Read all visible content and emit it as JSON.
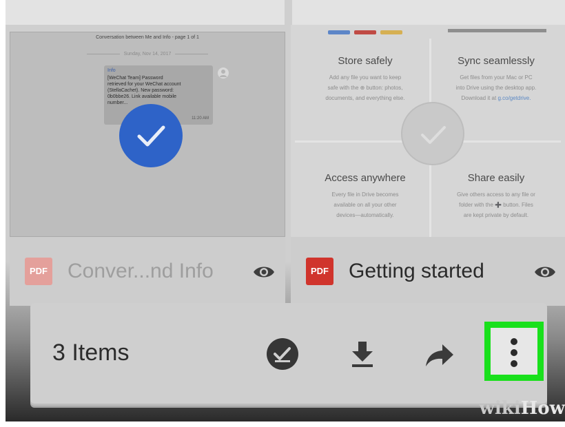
{
  "left_card": {
    "doc_header": "Conversation between Me and Info - page 1 of 1",
    "doc_date": "Sunday, Nov 14, 2017",
    "message": {
      "sender": "Info",
      "body": "[WeChat Team] Password\nretrieved for your WeChat account\n(StellaCachet). New password:\n0b0bbe26. Link available mobile\nnumber...",
      "time": "11:20 AM"
    },
    "selected_icon": "check-icon",
    "file_badge": "PDF",
    "file_name": "Conver...nd Info"
  },
  "right_card": {
    "features": [
      {
        "title": "Store safely",
        "desc_lines": [
          "Add any file you want to keep",
          "safe with the ⊕ button: photos,",
          "documents, and everything else."
        ]
      },
      {
        "title": "Sync seamlessly",
        "desc_lines": [
          "Get files from your Mac or PC",
          "into Drive using the desktop app.",
          "Download it at"
        ],
        "link": "g.co/getdrive."
      },
      {
        "title": "Access anywhere",
        "desc_lines": [
          "Every file in Drive becomes",
          "available on all your other",
          "devices—automatically."
        ]
      },
      {
        "title": "Share easily",
        "desc_lines": [
          "Give others access to any file or",
          "folder with the ➕ button. Files",
          "are kept private by default."
        ]
      }
    ],
    "file_badge": "PDF",
    "file_name": "Getting started"
  },
  "action_bar": {
    "count_label": "3 Items",
    "actions": [
      "select-all-icon",
      "download-icon",
      "share-icon",
      "more-vert-icon"
    ]
  },
  "colors": {
    "accent_blue": "#2e63c8",
    "pdf_red": "#d0342c",
    "pdf_red_dim": "#e4a09b",
    "highlight_green": "#19e01c"
  },
  "watermark": {
    "part1": "wiki",
    "part2": "How"
  }
}
